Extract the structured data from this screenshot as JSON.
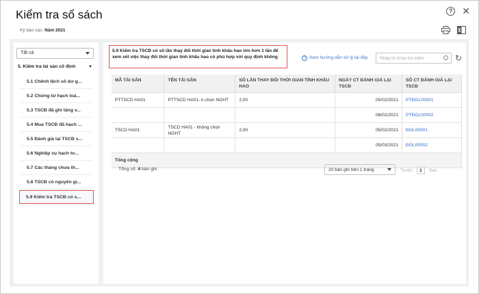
{
  "window": {
    "title": "Kiểm tra sổ sách",
    "help_symbol": "?",
    "close_symbol": "✕"
  },
  "period": {
    "label": "Kỳ báo cáo:",
    "value": "Năm 2021"
  },
  "sidebar": {
    "filter": "Tất cả",
    "group": "5. Kiểm tra tài sản cố định",
    "items": [
      {
        "label": "5.1 Chênh lệch số dư g..."
      },
      {
        "label": "5.2 Chứng từ hạch toá..."
      },
      {
        "label": "5.3 TSCĐ đã ghi tăng v..."
      },
      {
        "label": "5.4 Mua TSCĐ đã hạch ..."
      },
      {
        "label": "5.5 Đánh giá lại TSCĐ s..."
      },
      {
        "label": "5.6 Nghiệp vụ hạch to..."
      },
      {
        "label": "5.7 Các tháng chưa th..."
      },
      {
        "label": "5.8 TSCĐ có nguyên gi..."
      },
      {
        "label": "5.9 Kiểm tra TSCĐ có s..."
      }
    ]
  },
  "main": {
    "note": "5.9 Kiểm tra TSCĐ có số lần thay đổi thời gian tính khấu hao lớn hơn 1 lần để xem xét việc thay đổi thời gian tính khấu hao có phù hợp với quy định không",
    "help_link": "Xem hướng dẫn xử lý tại đây",
    "search_placeholder": "Nhập từ khóa tìm kiếm",
    "columns": [
      "MÃ TÀI SẢN",
      "TÊN TÀI SẢN",
      "SỐ LẦN THAY ĐỔI THỜI GIAN TÍNH KHẤU HAO",
      "NGÀY CT ĐÁNH GIÁ LẠI TSCĐ",
      "SỐ CT ĐÁNH GIÁ LẠI TSCĐ"
    ],
    "rows": [
      {
        "code": "PTTSCD HA01",
        "name": "PTTSCD HA01- k chọn NGHT",
        "count": "2,00",
        "date": "05/02/2021",
        "doc": "PTĐGL00001"
      },
      {
        "code": "",
        "name": "",
        "count": "",
        "date": "06/02/2021",
        "doc": "PTĐGL00002"
      },
      {
        "code": "TSCD HA01",
        "name": "TSCD HA01 - không chọn NGHT",
        "count": "2,00",
        "date": "05/02/2021",
        "doc": "ĐGL00001"
      },
      {
        "code": "",
        "name": "",
        "count": "",
        "date": "05/03/2021",
        "doc": "ĐGL00002"
      }
    ],
    "total_label": "Tổng cộng",
    "footer": {
      "count_prefix": "Tổng số:",
      "count_value": "4",
      "count_suffix": "bản ghi",
      "page_size": "20 bản ghi trên 1 trang",
      "prev": "Trước",
      "page": "1",
      "next": "Sau"
    }
  }
}
